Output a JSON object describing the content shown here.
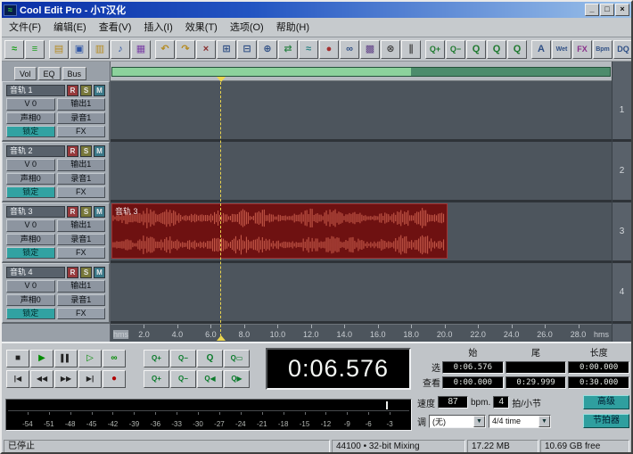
{
  "window": {
    "title": "Cool Edit Pro - 小T汉化",
    "controls": [
      {
        "id": "minimize",
        "glyph": "_"
      },
      {
        "id": "maximize",
        "glyph": "□"
      },
      {
        "id": "close",
        "glyph": "×"
      }
    ]
  },
  "icons": {
    "app_glyph": "≈",
    "dropdown_arrow": "▼"
  },
  "menu": {
    "items": [
      {
        "id": "file",
        "label": "文件(F)"
      },
      {
        "id": "edit",
        "label": "编辑(E)"
      },
      {
        "id": "view",
        "label": "查看(V)"
      },
      {
        "id": "insert",
        "label": "插入(I)"
      },
      {
        "id": "effects",
        "label": "效果(T)"
      },
      {
        "id": "options",
        "label": "选项(O)"
      },
      {
        "id": "help",
        "label": "帮助(H)"
      }
    ]
  },
  "toolbar": {
    "groups": [
      {
        "buttons": [
          {
            "name": "edit-waveform-view",
            "glyph": "≈",
            "color": "#1fa01f"
          },
          {
            "name": "multitrack-view",
            "glyph": "≡",
            "color": "#1fa01f"
          }
        ]
      },
      {
        "buttons": [
          {
            "name": "open-file",
            "glyph": "▤",
            "color": "#b58a1e"
          },
          {
            "name": "save-session",
            "glyph": "▣",
            "color": "#2f55a5"
          },
          {
            "name": "import-file",
            "glyph": "▥",
            "color": "#b58a1e"
          },
          {
            "name": "insert-wave",
            "glyph": "♪",
            "color": "#2f55a5"
          },
          {
            "name": "export-mixdown",
            "glyph": "▦",
            "color": "#7a3fa5"
          }
        ]
      },
      {
        "buttons": [
          {
            "name": "undo",
            "glyph": "↶",
            "color": "#b58a1e"
          },
          {
            "name": "redo",
            "glyph": "↷",
            "color": "#b58a1e"
          },
          {
            "name": "cut-clip",
            "glyph": "×",
            "color": "#8a2f2f"
          },
          {
            "name": "copy-clip",
            "glyph": "⊞",
            "color": "#2f4f85"
          },
          {
            "name": "paste-clip",
            "glyph": "⊟",
            "color": "#2f4f85"
          },
          {
            "name": "mix-paste",
            "glyph": "⊕",
            "color": "#2f4f85"
          },
          {
            "name": "crossfade",
            "glyph": "⇄",
            "color": "#2f8548"
          },
          {
            "name": "clip-envelope",
            "glyph": "≈",
            "color": "#2f8585"
          },
          {
            "name": "punch-in",
            "glyph": "●",
            "color": "#a52f2f"
          },
          {
            "name": "loop-duplicate",
            "glyph": "∞",
            "color": "#2f4f85"
          },
          {
            "name": "group-clips",
            "glyph": "▩",
            "color": "#5f3f85"
          },
          {
            "name": "lock-clip-time",
            "glyph": "⊗",
            "color": "#444444"
          },
          {
            "name": "split-clip",
            "glyph": "∥",
            "color": "#444444"
          }
        ]
      },
      {
        "buttons": [
          {
            "name": "zoom-in-toolbar",
            "glyph": "Q+",
            "color": "#1f7a2f"
          },
          {
            "name": "zoom-out-toolbar",
            "glyph": "Q−",
            "color": "#1f7a2f"
          },
          {
            "name": "zoom-selection-toolbar",
            "glyph": "Q",
            "color": "#1f7a2f"
          },
          {
            "name": "zoom-prev",
            "glyph": "Q",
            "color": "#1f7a2f"
          },
          {
            "name": "zoom-next",
            "glyph": "Q",
            "color": "#1f7a2f"
          }
        ]
      },
      {
        "buttons": [
          {
            "name": "volume-envelope",
            "glyph": "A",
            "color": "#2f4f85"
          },
          {
            "name": "wet-dry-envelope",
            "glyph": "Wet",
            "color": "#2f4f85"
          },
          {
            "name": "fx-rack",
            "glyph": "FX",
            "color": "#8a2f8a"
          },
          {
            "name": "bpm-dialog",
            "glyph": "Bpm",
            "color": "#2f4f85"
          },
          {
            "name": "quantize",
            "glyph": "DQ",
            "color": "#2f4f85"
          },
          {
            "name": "snap-toggle",
            "glyph": "#",
            "color": "#444444"
          },
          {
            "name": "scroll-toggle",
            "glyph": "⇄",
            "color": "#444444"
          }
        ]
      },
      {
        "buttons": [
          {
            "name": "session-properties",
            "glyph": "◷",
            "color": "#1f8585"
          },
          {
            "name": "mixer-window",
            "glyph": "≡",
            "color": "#1f8585"
          },
          {
            "name": "cue-list",
            "glyph": "▤",
            "color": "#b58a1e"
          },
          {
            "name": "help-context",
            "glyph": "?",
            "color": "#1f7a2f"
          }
        ]
      }
    ]
  },
  "left_panel": {
    "tabs": [
      {
        "id": "vol",
        "label": "Vol"
      },
      {
        "id": "eq",
        "label": "EQ"
      },
      {
        "id": "bus",
        "label": "Bus"
      }
    ],
    "tracks": [
      {
        "name": "音轨 1",
        "arm": "R",
        "solo": "S",
        "mute": "M",
        "volume": "V 0",
        "output": "输出1",
        "pan": "声相0",
        "record_device": "录音1",
        "lock": "锁定",
        "fx": "FX"
      },
      {
        "name": "音轨 2",
        "arm": "R",
        "solo": "S",
        "mute": "M",
        "volume": "V 0",
        "output": "输出1",
        "pan": "声相0",
        "record_device": "录音1",
        "lock": "锁定",
        "fx": "FX"
      },
      {
        "name": "音轨 3",
        "arm": "R",
        "solo": "S",
        "mute": "M",
        "volume": "V 0",
        "output": "输出1",
        "pan": "声相0",
        "record_device": "录音1",
        "lock": "锁定",
        "fx": "FX"
      },
      {
        "name": "音轨 4",
        "arm": "R",
        "solo": "S",
        "mute": "M",
        "volume": "V 0",
        "output": "输出1",
        "pan": "声相0",
        "record_device": "录音1",
        "lock": "锁定",
        "fx": "FX"
      }
    ]
  },
  "timeline": {
    "clip": {
      "label": "音轨 3",
      "track": 3
    },
    "ruler": {
      "unit_left": "hms",
      "unit_right": "hms",
      "total_seconds": 30,
      "ticks": [
        "2.0",
        "4.0",
        "6.0",
        "8.0",
        "10.0",
        "12.0",
        "14.0",
        "16.0",
        "18.0",
        "20.0",
        "22.0",
        "24.0",
        "26.0",
        "28.0"
      ]
    },
    "track_numbers": [
      "1",
      "2",
      "3",
      "4"
    ]
  },
  "transport": {
    "rows": [
      [
        {
          "name": "stop",
          "glyph": "■",
          "color": "#222222"
        },
        {
          "name": "play",
          "glyph": "▶",
          "color": "#008a00"
        },
        {
          "name": "pause",
          "glyph": "▌▌",
          "color": "#222222"
        },
        {
          "name": "play-from-cursor",
          "glyph": "▷",
          "color": "#008a00"
        },
        {
          "name": "play-looped",
          "glyph": "∞",
          "color": "#008a00"
        }
      ],
      [
        {
          "name": "go-to-start",
          "glyph": "|◀",
          "color": "#222222"
        },
        {
          "name": "rewind",
          "glyph": "◀◀",
          "color": "#222222"
        },
        {
          "name": "fast-forward",
          "glyph": "▶▶",
          "color": "#222222"
        },
        {
          "name": "go-to-end",
          "glyph": "▶|",
          "color": "#222222"
        },
        {
          "name": "record",
          "glyph": "●",
          "color": "#b00000"
        }
      ]
    ]
  },
  "zoom_controls": {
    "rows": [
      [
        {
          "name": "zoom-in-horizontal",
          "glyph": "Q+",
          "color": "#0a7a2a"
        },
        {
          "name": "zoom-out-horizontal",
          "glyph": "Q−",
          "color": "#0a7a2a"
        },
        {
          "name": "zoom-out-full",
          "glyph": "Q",
          "color": "#0a7a2a"
        },
        {
          "name": "zoom-to-selection",
          "glyph": "Q▭",
          "color": "#0a7a2a"
        }
      ],
      [
        {
          "name": "zoom-in-vertical",
          "glyph": "Q+",
          "color": "#0a7a2a"
        },
        {
          "name": "zoom-out-vertical",
          "glyph": "Q−",
          "color": "#0a7a2a"
        },
        {
          "name": "zoom-left-edge",
          "glyph": "Q◀",
          "color": "#0a7a2a"
        },
        {
          "name": "zoom-right-edge",
          "glyph": "Q▶",
          "color": "#0a7a2a"
        }
      ]
    ]
  },
  "time_display": {
    "value": "0:06.576"
  },
  "selection_info": {
    "headers": [
      "始",
      "尾",
      "长度"
    ],
    "rows": [
      {
        "label": "选",
        "values": [
          "0:06.576",
          "",
          "0:00.000"
        ]
      },
      {
        "label": "查看",
        "values": [
          "0:00.000",
          "0:29.999",
          "0:30.000"
        ]
      }
    ]
  },
  "meter": {
    "scale": [
      "-54",
      "-51",
      "-48",
      "-45",
      "-42",
      "-39",
      "-36",
      "-33",
      "-30",
      "-27",
      "-24",
      "-21",
      "-18",
      "-15",
      "-12",
      "-9",
      "-6",
      "-3"
    ]
  },
  "tempo": {
    "speed_label": "速度",
    "bpm_value": "87",
    "bpm_unit": "bpm.",
    "beats_value": "4",
    "beats_unit": "拍/小节",
    "advanced_label": "高级",
    "key_label": "调",
    "key_value": "(无)",
    "time_signature": "4/4 time",
    "metronome_label": "节拍器"
  },
  "status_bar": {
    "state": "已停止",
    "items": [
      "44100 • 32-bit Mixing",
      "17.22 MB",
      "10.69 GB free"
    ]
  }
}
